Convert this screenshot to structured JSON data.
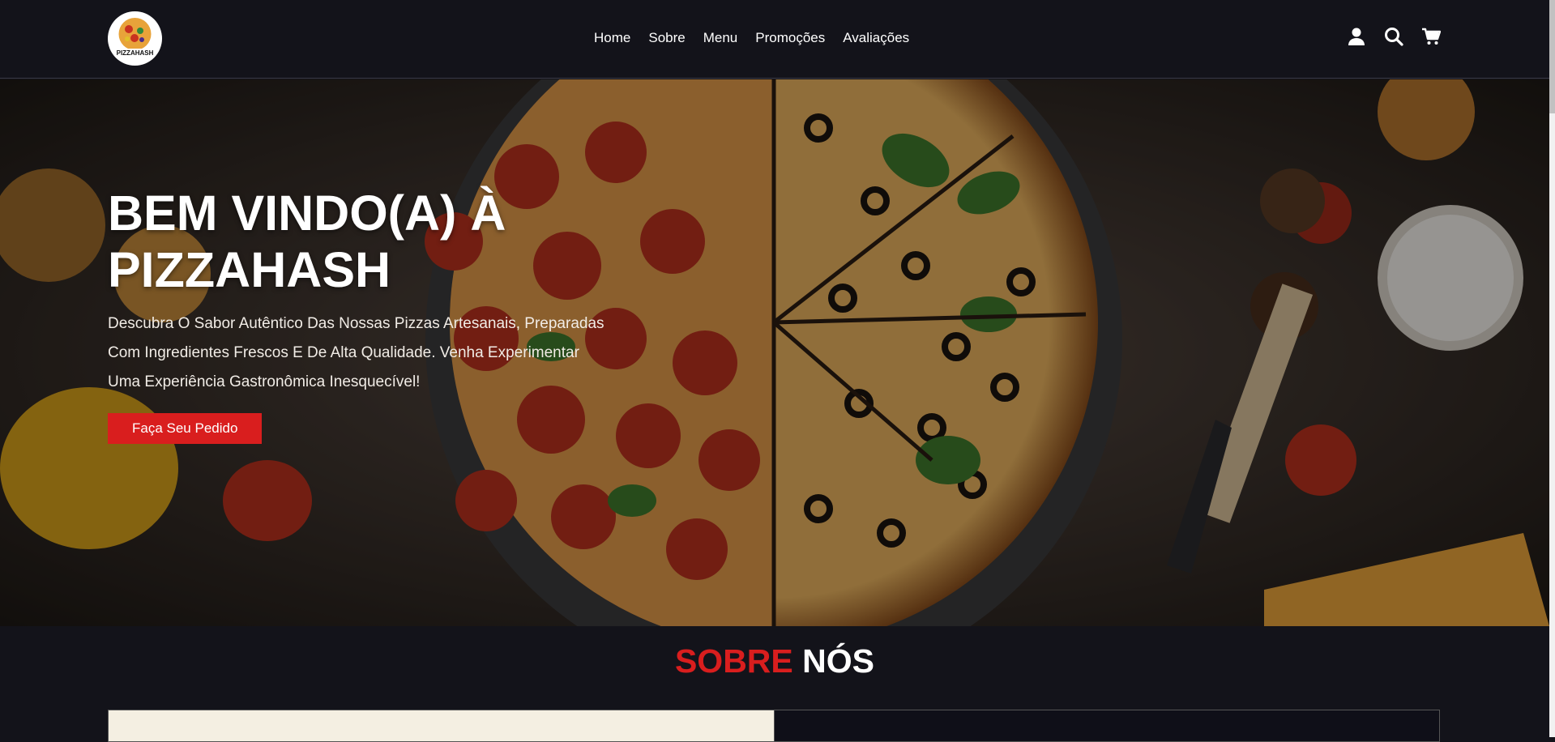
{
  "header": {
    "logo_alt": "PIZZAHASH",
    "nav": [
      "Home",
      "Sobre",
      "Menu",
      "Promoções",
      "Avaliações"
    ],
    "icons": [
      "user-icon",
      "search-icon",
      "cart-icon"
    ]
  },
  "hero": {
    "title_line1": "BEM VINDO(A) À",
    "title_line2": "PIZZAHASH",
    "subtitle": "Descubra O Sabor Autêntico Das Nossas Pizzas Artesanais, Preparadas Com Ingredientes Frescos E De Alta Qualidade. Venha Experimentar Uma Experiência Gastronômica Inesquecível!",
    "cta_label": "Faça Seu Pedido"
  },
  "about": {
    "title_red": "SOBRE",
    "title_white": "NÓS"
  },
  "colors": {
    "accent": "#d91e1e",
    "background": "#13131a"
  }
}
